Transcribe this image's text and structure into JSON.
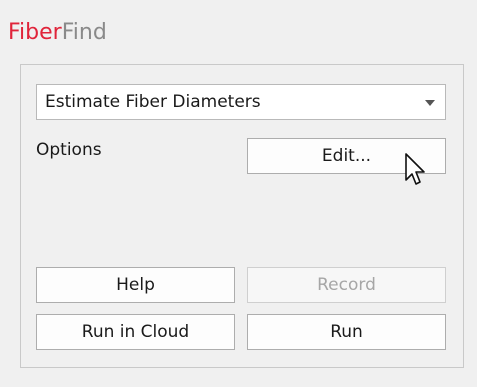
{
  "app": {
    "title_primary": "Fiber",
    "title_secondary": "Find",
    "brand_colors": {
      "primary": "#e0243a",
      "secondary": "#8a8a8a"
    }
  },
  "operation_select": {
    "selected": "Estimate Fiber Diameters"
  },
  "options": {
    "label": "Options",
    "edit_label": "Edit..."
  },
  "buttons": {
    "help": "Help",
    "record": "Record",
    "run_in_cloud": "Run in Cloud",
    "run": "Run"
  },
  "cursor": {
    "icon": "pointer-cursor-icon"
  }
}
